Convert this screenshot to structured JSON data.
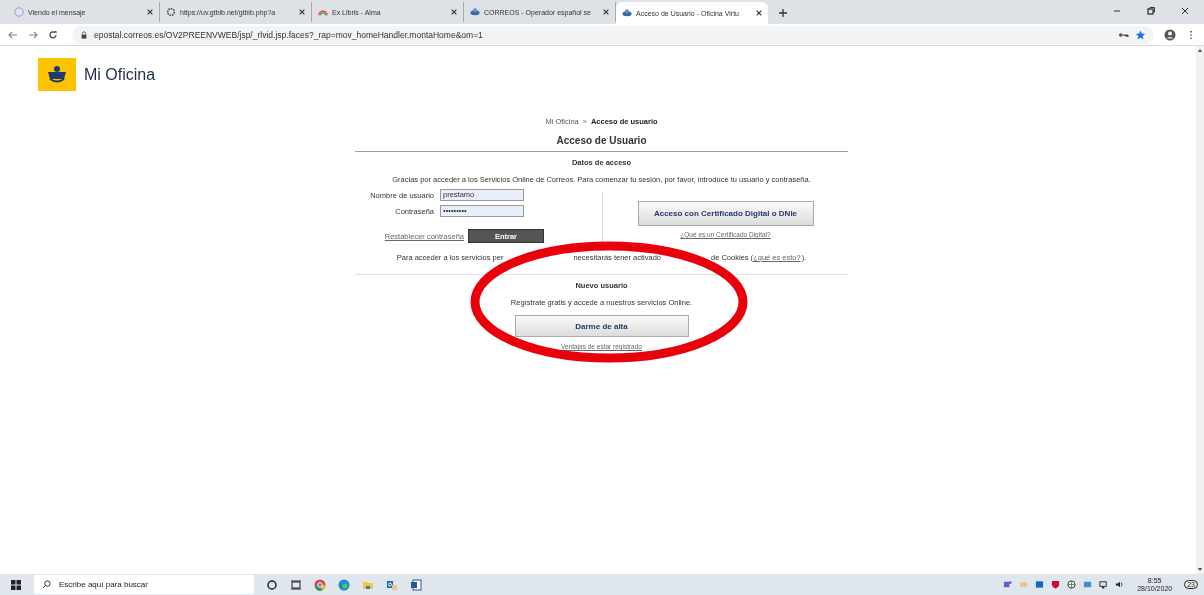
{
  "tabs": [
    {
      "title": "Viendo el mensaje",
      "selected": false
    },
    {
      "title": "https://uv.gtbib.net/gtbib.php?a",
      "selected": false
    },
    {
      "title": "Ex Libris - Alma",
      "selected": false
    },
    {
      "title": "CORREOS - Operador español se",
      "selected": false
    },
    {
      "title": "Acceso de Usuario - Oficina Virtu",
      "selected": true
    }
  ],
  "address": {
    "url": "epostal.correos.es/OV2PREENVWEB/jsp/_rlvid.jsp.faces?_rap=mov_homeHandler.montaHome&om=1"
  },
  "page": {
    "logo_text": "Mi Oficina",
    "breadcrumb": [
      {
        "label": "Mi Oficina",
        "current": false
      },
      {
        "label": "Acceso de usuario",
        "current": true
      }
    ],
    "breadcrumb_separator": "»",
    "heading": "Acceso de Usuario",
    "section_title": "Datos de acceso",
    "intro": "Gracias por acceder a los Servicios Online de Correos. Para comenzar tu sesión, por favor, introduce tu usuario y contraseña.",
    "fields": [
      {
        "label": "Nombre de usuario",
        "value": "prestamo"
      },
      {
        "label": "Contraseña",
        "value": "•••••••••"
      }
    ],
    "reset_link": "Restablecer contraseña",
    "submit_button": "Entrar",
    "cert_button": "Acceso con Certificado Digital o DNIe",
    "cert_link": "¿Qué es un Certificado Digital?",
    "cookies_parts": [
      "Para acceder a los servicios per",
      "necesitarás tener activado",
      "de Cookies ("
    ],
    "cookies_link": "¿qué es esto?",
    "cookies_end": ").",
    "new_user": {
      "title": "Nuevo usuario",
      "text": "Regístrate gratis y accede a nuestros servicios Online.",
      "button": "Darme de alta",
      "link": "Ventajas de estar registrado"
    }
  },
  "taskbar": {
    "search_placeholder": "Escribe aquí para buscar",
    "time": "8:55",
    "date": "28/10/2020",
    "notifications": "23"
  }
}
